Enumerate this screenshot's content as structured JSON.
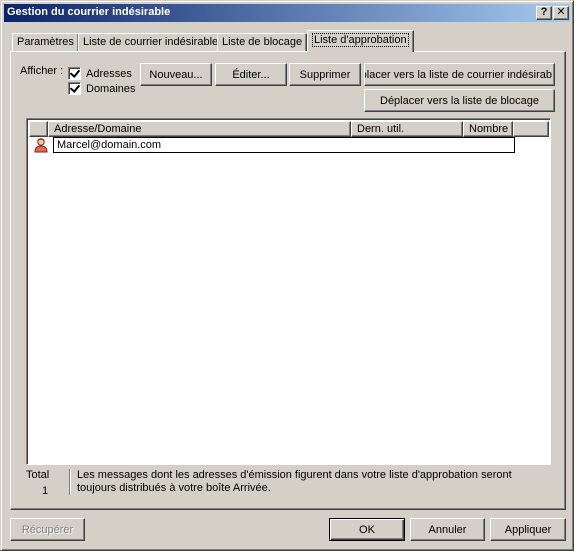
{
  "window": {
    "title": "Gestion du courrier indésirable",
    "help_label": "?",
    "close_label": "✕"
  },
  "tabs": [
    {
      "label": "Paramètres"
    },
    {
      "label": "Liste de courrier indésirable"
    },
    {
      "label": "Liste de blocage"
    },
    {
      "label": "Liste d'approbation"
    }
  ],
  "filters": {
    "show_label": "Afficher :",
    "addresses_label": "Adresses",
    "domains_label": "Domaines"
  },
  "toolbar": {
    "new_label": "Nouveau...",
    "edit_label": "Éditer...",
    "delete_label": "Supprimer",
    "move_to_junk_label": "éplacer vers la liste de courrier indésirab",
    "move_to_block_label": "Déplacer vers la liste de blocage"
  },
  "list": {
    "columns": [
      {
        "label": "Adresse/Domaine"
      },
      {
        "label": "Dern. util."
      },
      {
        "label": "Nombre"
      }
    ],
    "rows": [
      {
        "address": "Marcel@domain.com",
        "icon": "contact-icon"
      }
    ]
  },
  "footer": {
    "total_label": "Total",
    "total_value": "1",
    "info_text_1": "Les messages dont les adresses d'émission figurent dans votre liste d'approbation seront",
    "info_text_2": "toujours distribués à votre boîte Arrivée."
  },
  "buttons": {
    "recover_label": "Récupérer",
    "ok_label": "OK",
    "cancel_label": "Annuler",
    "apply_label": "Appliquer"
  },
  "colors": {
    "title_start": "#0a246a",
    "title_end": "#a6caf0",
    "face": "#d4d0c8"
  }
}
